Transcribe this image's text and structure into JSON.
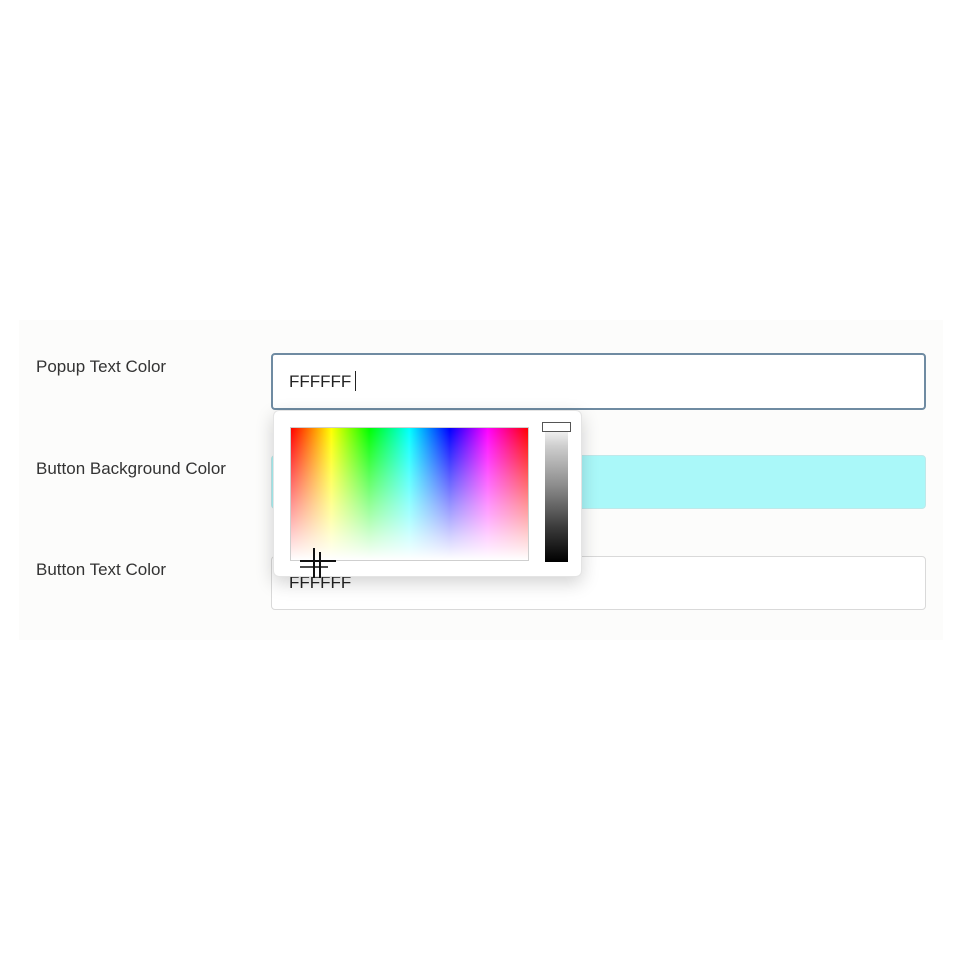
{
  "form": {
    "popup_text_color": {
      "label": "Popup Text Color",
      "value": "FFFFFF"
    },
    "button_background_color": {
      "label": "Button Background Color",
      "value": "",
      "swatch": "#aaf8f9"
    },
    "button_text_color": {
      "label": "Button Text Color",
      "value": "FFFFFF"
    }
  },
  "colors": {
    "panel_background": "#fcfcfb",
    "focused_border": "#6f8ba2",
    "button_background_swatch": "#aaf8f9"
  },
  "icons": {
    "cursor": "crosshair-icon"
  }
}
